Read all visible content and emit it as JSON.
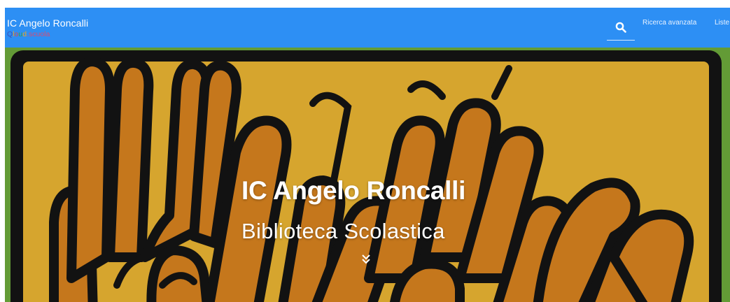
{
  "navbar": {
    "brand_title": "IC Angelo Roncalli",
    "brand_subtitle_parts": [
      "Q",
      "l",
      "o",
      "u",
      "d",
      ".scuola"
    ],
    "search_icon": "search-icon",
    "links": {
      "advanced_search": "Ricerca avanzata",
      "lists": "Liste"
    },
    "colors": {
      "navbar_bg": "#2d8ff4",
      "text": "#ffffff"
    }
  },
  "hero": {
    "title": "IC Angelo Roncalli",
    "subtitle": "Biblioteca Scolastica",
    "scroll_icon": "chevron-double-down-icon",
    "colors": {
      "background_green": "#6aa53a",
      "panel_yellow": "#e4b031",
      "figure_orange": "#d27f1e",
      "outline_black": "#141414"
    }
  }
}
